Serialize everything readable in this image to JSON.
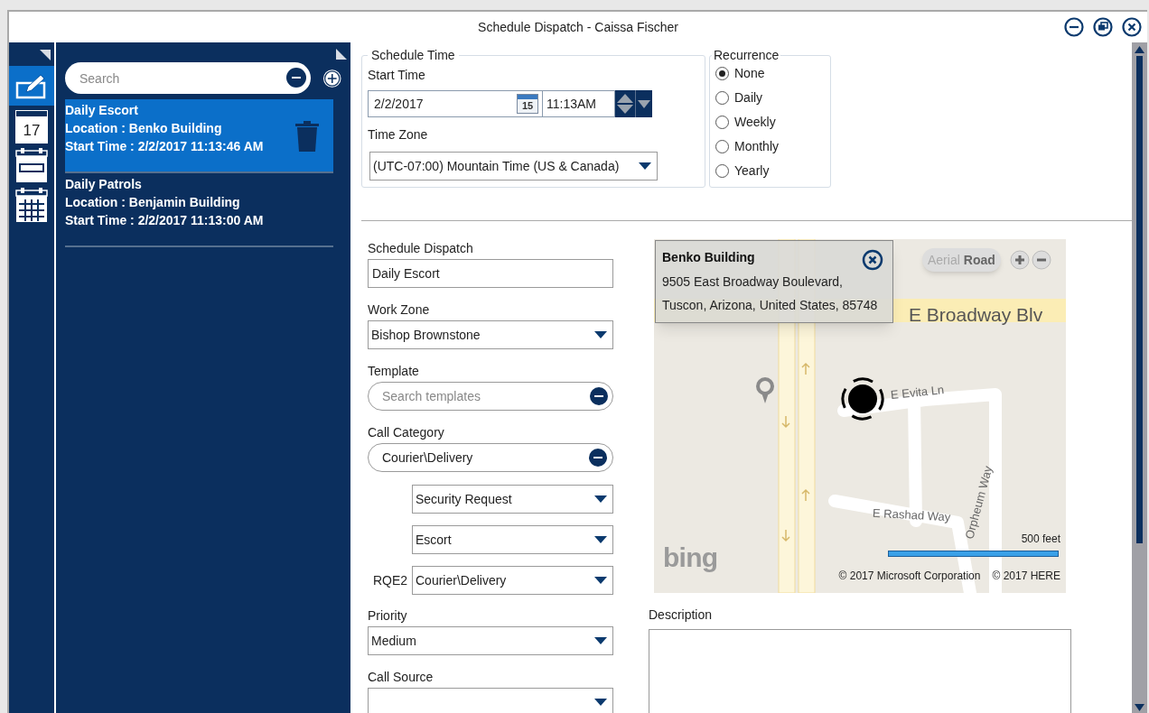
{
  "window": {
    "title": "Schedule Dispatch - Caissa Fischer"
  },
  "rail": [
    {
      "kind": "edit",
      "selected": true
    },
    {
      "kind": "day",
      "label": "17",
      "selected": false
    },
    {
      "kind": "week",
      "selected": false
    },
    {
      "kind": "month",
      "selected": false
    }
  ],
  "list": {
    "search": {
      "placeholder": "Search"
    },
    "items": [
      {
        "title": "Daily Escort",
        "location": "Location : Benko Building",
        "start": "Start Time : 2/2/2017 11:13:46 AM",
        "selected": true
      },
      {
        "title": "Daily Patrols",
        "location": "Location : Benjamin Building",
        "start": "Start Time : 2/2/2017 11:13:00 AM",
        "selected": false
      }
    ]
  },
  "schedule_time": {
    "legend": "Schedule Time",
    "start_label": "Start Time",
    "date": "2/2/2017",
    "calendar_day": "15",
    "time": "11:13AM",
    "zone_label": "Time Zone",
    "zone": "(UTC-07:00) Mountain Time (US & Canada)"
  },
  "recurrence": {
    "legend": "Recurrence",
    "options": [
      {
        "label": "None",
        "selected": true
      },
      {
        "label": "Daily",
        "selected": false
      },
      {
        "label": "Weekly",
        "selected": false
      },
      {
        "label": "Monthly",
        "selected": false
      },
      {
        "label": "Yearly",
        "selected": false
      }
    ]
  },
  "form": [
    {
      "kind": "text",
      "label": "Schedule Dispatch",
      "value": "Daily Escort"
    },
    {
      "kind": "dropdown",
      "label": "Work Zone",
      "value": "Bishop Brownstone"
    },
    {
      "kind": "search",
      "label": "Template",
      "placeholder": "Search templates"
    },
    {
      "kind": "search",
      "label": "Call Category",
      "value": "Courier\\Delivery"
    },
    {
      "kind": "subdropdown",
      "value": "Security Request"
    },
    {
      "kind": "subdropdown",
      "value": "Escort"
    },
    {
      "kind": "subdropdown",
      "prefix": "RQE2",
      "value": "Courier\\Delivery"
    },
    {
      "kind": "dropdown",
      "label": "Priority",
      "value": "Medium"
    },
    {
      "kind": "dropdown",
      "label": "Call Source"
    }
  ],
  "map": {
    "popup": {
      "title": "Benko Building",
      "address": [
        "9505 East Broadway Boulevard,",
        "Tuscon, Arizona, United States, 85748"
      ]
    },
    "map_types": [
      {
        "label": "Aerial",
        "selected": false
      },
      {
        "label": "Road",
        "selected": true
      }
    ],
    "streets": [
      "E Broadway Blv",
      "E Evita Ln",
      "E Rashad Way",
      "Orpheum Way"
    ],
    "scale": "500 feet",
    "logo": "bing",
    "copyrights": [
      "© 2017 Microsoft Corporation",
      "© 2017 HERE"
    ]
  },
  "description": {
    "label": "Description"
  }
}
